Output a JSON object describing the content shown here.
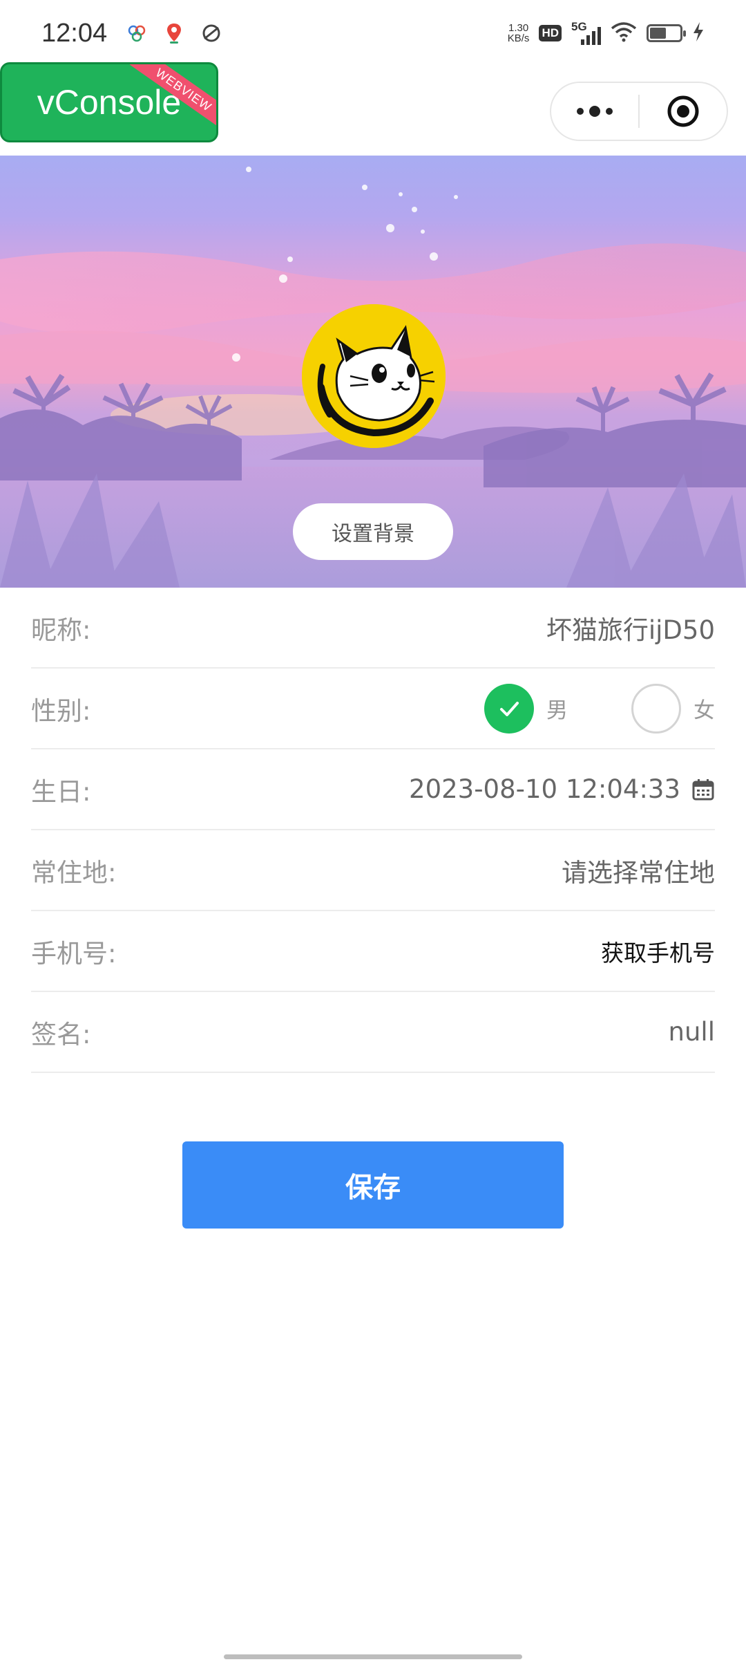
{
  "status_bar": {
    "time": "12:04",
    "net_speed_value": "1.30",
    "net_speed_unit": "KB/s",
    "hd_badge": "HD",
    "network_type": "5G",
    "battery_level": 0.55
  },
  "header": {
    "vconsole_label": "vConsole",
    "vconsole_ribbon": "WEBVIEW"
  },
  "hero": {
    "set_background_label": "设置背景"
  },
  "form": {
    "nickname": {
      "label": "昵称:",
      "value": "坏猫旅行ijD50"
    },
    "gender": {
      "label": "性别:",
      "male": "男",
      "female": "女",
      "selected": "男"
    },
    "birthday": {
      "label": "生日:",
      "value": "2023-08-10 12:04:33"
    },
    "residence": {
      "label": "常住地:",
      "placeholder": "请选择常住地"
    },
    "phone": {
      "label": "手机号:",
      "action": "获取手机号"
    },
    "signature": {
      "label": "签名:",
      "value": "null"
    }
  },
  "save_label": "保存",
  "colors": {
    "primary_blue": "#3a8cf7",
    "check_green": "#1dbf5e",
    "vconsole_green": "#1fb35a",
    "avatar_yellow": "#f6d100"
  }
}
